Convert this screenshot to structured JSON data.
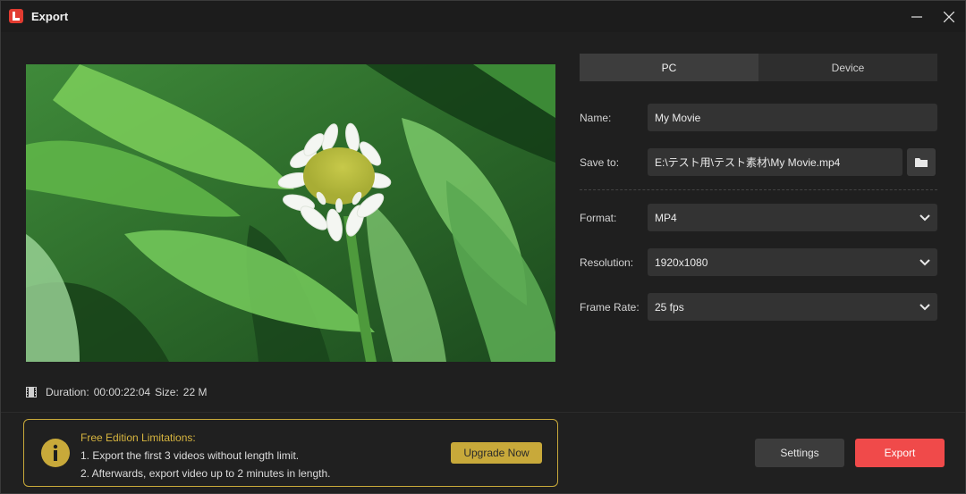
{
  "window": {
    "title": "Export"
  },
  "icons": {
    "app": "app-logo-icon",
    "minimize": "minimize-icon",
    "close": "close-icon",
    "film": "film-icon",
    "folder": "folder-icon",
    "chevron": "chevron-down-icon",
    "info": "info-icon"
  },
  "preview": {
    "description_icon": "video-thumbnail"
  },
  "info": {
    "duration_label": "Duration:",
    "duration_value": "00:00:22:04",
    "size_label": "Size:",
    "size_value": "22 M"
  },
  "tabs": [
    {
      "label": "PC",
      "active": true
    },
    {
      "label": "Device",
      "active": false
    }
  ],
  "form": {
    "name_label": "Name:",
    "name_value": "My Movie",
    "save_label": "Save to:",
    "save_value": "E:\\テスト用\\テスト素材\\My Movie.mp4",
    "format_label": "Format:",
    "format_value": "MP4",
    "resolution_label": "Resolution:",
    "resolution_value": "1920x1080",
    "framerate_label": "Frame Rate:",
    "framerate_value": "25 fps"
  },
  "limits": {
    "title": "Free Edition Limitations:",
    "line1": "1. Export the first 3 videos without length limit.",
    "line2": "2. Afterwards, export video up to 2 minutes in length.",
    "upgrade_label": "Upgrade Now"
  },
  "buttons": {
    "settings_label": "Settings",
    "export_label": "Export"
  },
  "colors": {
    "accent_red": "#f04a4a",
    "gold": "#c8a93a",
    "background": "#1f1f1f"
  }
}
